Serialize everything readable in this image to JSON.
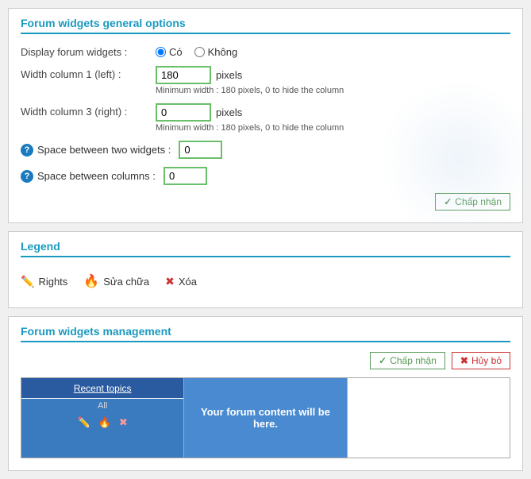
{
  "general_options": {
    "title": "Forum widgets general options",
    "display_label": "Display forum widgets :",
    "radio_co": "Có",
    "radio_khong": "Không",
    "width_col1_label": "Width column 1 (left) :",
    "width_col1_value": "180",
    "width_col1_unit": "pixels",
    "width_col1_note": "Minimum width : 180 pixels, 0 to hide the column",
    "width_col3_label": "Width column 3 (right) :",
    "width_col3_value": "0",
    "width_col3_unit": "pixels",
    "width_col3_note": "Minimum width : 180 pixels, 0 to hide the column",
    "space_widgets_label": "Space between two widgets :",
    "space_widgets_value": "0",
    "space_columns_label": "Space between columns :",
    "space_columns_value": "0",
    "submit_label": "Chấp nhận"
  },
  "legend": {
    "title": "Legend",
    "items": [
      {
        "key": "rights",
        "label": "Rights"
      },
      {
        "key": "edit",
        "label": "Sửa chữa"
      },
      {
        "key": "delete",
        "label": "Xóa"
      }
    ]
  },
  "management": {
    "title": "Forum widgets management",
    "submit_label": "Chấp nhận",
    "cancel_label": "Hủy bỏ",
    "widget1_title": "Recent topics",
    "widget1_sub": "All",
    "widget2_placeholder": "Your forum content will be here.",
    "widget3_placeholder": ""
  }
}
